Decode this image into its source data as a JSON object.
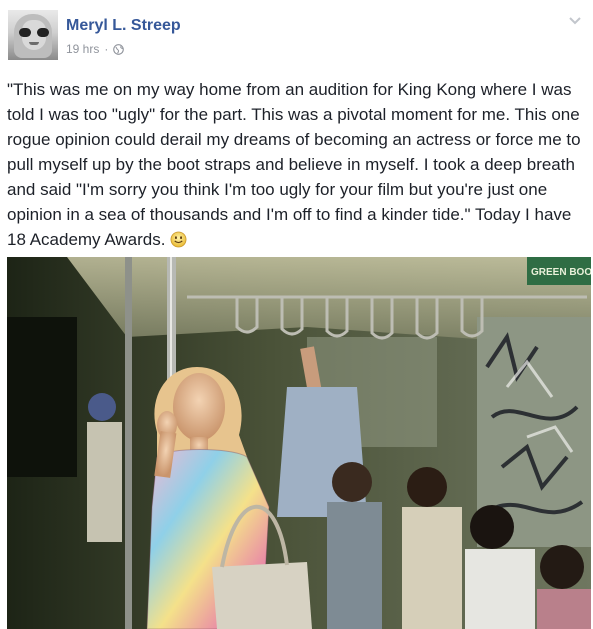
{
  "post": {
    "author": "Meryl L. Streep",
    "timestamp": "19 hrs",
    "separator": "·",
    "privacy_icon": "globe-icon",
    "menu_icon": "chevron-down-icon",
    "text": "\"This was me on my way home from an audition for King Kong where I was told I was too \"ugly\" for the part. This was a pivotal moment for me. This one rogue opinion could derail my dreams of becoming an actress or force me to pull myself up by the boot straps and believe in myself. I took a deep breath and said \"I'm sorry you think I'm too ugly for your film but you're just one opinion in a sea of thousands and I'm off to find a kinder tide.\" Today I have 18 Academy Awards.",
    "emoji": "smiley-icon",
    "photo_caption_sign": "GREEN BOO"
  },
  "colors": {
    "author_link": "#365899",
    "meta_text": "#90949c",
    "body_text": "#1d2129"
  }
}
